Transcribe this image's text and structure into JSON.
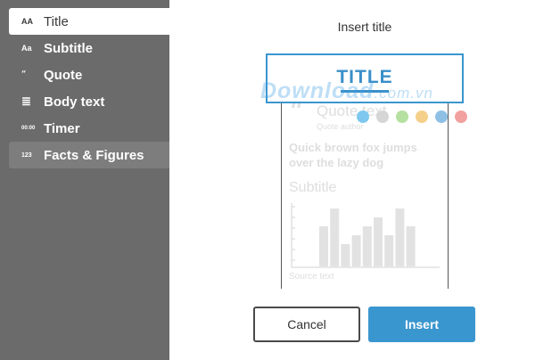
{
  "sidebar": {
    "items": [
      {
        "icon": "AA",
        "label": "Title"
      },
      {
        "icon": "Aa",
        "label": "Subtitle"
      },
      {
        "icon": "“",
        "label": "Quote"
      },
      {
        "icon": "≣",
        "label": "Body text"
      },
      {
        "icon": "00:00",
        "label": "Timer"
      },
      {
        "icon": "123",
        "label": "Facts & Figures"
      }
    ]
  },
  "dialog": {
    "title": "Insert title",
    "cancel_label": "Cancel",
    "insert_label": "Insert"
  },
  "preview": {
    "title_word": "TITLE",
    "quote_mark": "“",
    "quote_text": "Quote text",
    "quote_author": "Quote author",
    "body_line1": "Quick brown fox jumps",
    "body_line2": "over the lazy dog",
    "subtitle": "Subtitle",
    "source": "Source text",
    "dot_colors": [
      "#7ec8f0",
      "#d6d6d6",
      "#b6e0a0",
      "#f5d08a",
      "#8ec0e6",
      "#f2a0a0"
    ],
    "chart_bar_levels": [
      0.45,
      0.65,
      0.25,
      0.35,
      0.45,
      0.55,
      0.35,
      0.65,
      0.45
    ]
  },
  "watermark": {
    "main": "Download",
    "suffix": ".com.vn"
  },
  "colors": {
    "accent": "#3a96cf",
    "sidebar_bg": "#6b6b6b"
  }
}
